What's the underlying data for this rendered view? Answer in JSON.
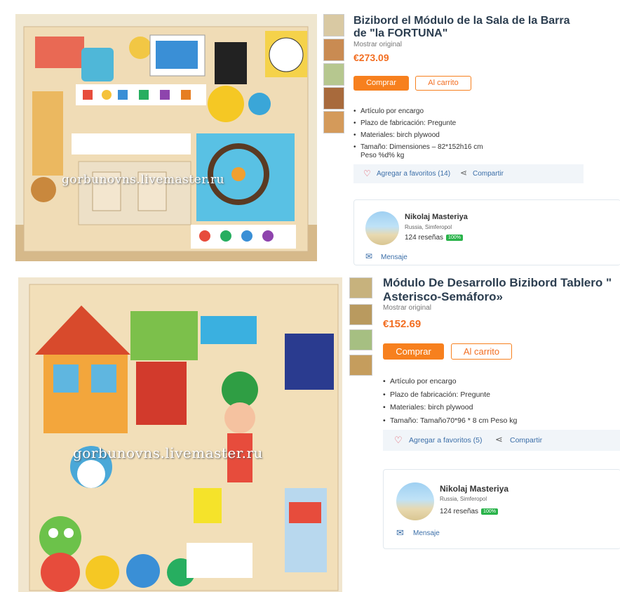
{
  "products": [
    {
      "title_line1": "Bizibord el Módulo de la Sala de la Barra",
      "title_line2": "de \"la FORTUNA\"",
      "show_original": "Mostrar original",
      "price": "€273.09",
      "buy_label": "Comprar",
      "cart_label": "Al carrito",
      "properties": [
        "Artículo por encargo",
        "Plazo de fabricación: Pregunte",
        "Materiales:  birch plywood",
        "Tamaño: Dimensiones – 82*152h16 cm",
        "Peso %d% kg"
      ],
      "favorites_label": "Agregar a favoritos (14)",
      "share_label": "Compartir",
      "seller_name": "Nikolaj Masteriya",
      "seller_location": "Russia, Simferopol",
      "reviews": "124 reseñas",
      "rating": "100%",
      "message_label": "Mensaje",
      "watermark": "gorbunovns.livemaster.ru"
    },
    {
      "title_line1": "Módulo De Desarrollo Bizibord Tablero \"",
      "title_line2": "Asterisco-Semáforo»",
      "show_original": "Mostrar original",
      "price": "€152.69",
      "buy_label": "Comprar",
      "cart_label": "Al carrito",
      "properties": [
        "Artículo por encargo",
        "Plazo de fabricación: Pregunte",
        "Materiales:  birch plywood",
        "Tamaño: Tamaño70*96 * 8 cm Peso kg"
      ],
      "favorites_label": "Agregar a favoritos (5)",
      "share_label": "Compartir",
      "seller_name": "Nikolaj Masteriya",
      "seller_location": "Russia, Simferopol",
      "reviews": "124 reseñas",
      "rating": "100%",
      "message_label": "Mensaje",
      "watermark": "gorbunovns.livemaster.ru"
    }
  ],
  "colors": {
    "accent": "#f7801e",
    "price": "#f26e22",
    "link": "#3b6ea8",
    "title": "#2c3e50",
    "badge": "#29b34a"
  }
}
